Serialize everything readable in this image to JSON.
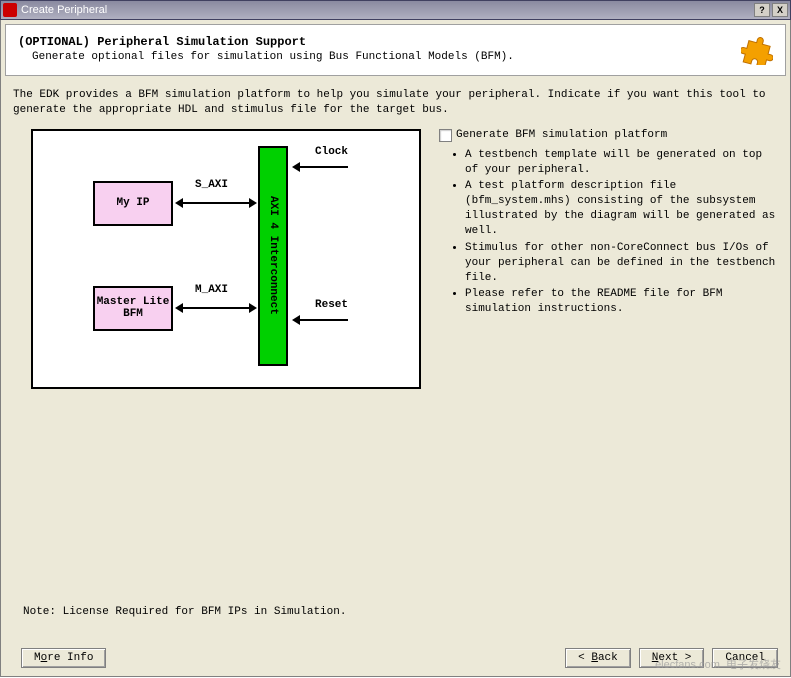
{
  "titlebar": {
    "title": "Create Peripheral",
    "help": "?",
    "close": "X"
  },
  "header": {
    "title": "(OPTIONAL) Peripheral Simulation Support",
    "subtitle": "Generate optional files for simulation using Bus Functional Models (BFM)."
  },
  "intro": "The EDK provides a BFM simulation platform to help you simulate your peripheral. Indicate if you want this tool to generate the appropriate HDL and stimulus file for the target bus.",
  "checkbox": {
    "label": "Generate BFM simulation platform"
  },
  "bullets": {
    "b1": "A testbench template will be generated on top of your peripheral.",
    "b2": "A test platform description file (bfm_system.mhs) consisting of the subsystem illustrated by the diagram will be generated as well.",
    "b3": "Stimulus for other non-CoreConnect bus I/Os of your peripheral can be defined in the testbench file.",
    "b4": "Please refer to the README file for BFM simulation instructions."
  },
  "diagram": {
    "my_ip": "My IP",
    "master": "Master Lite\nBFM",
    "s_axi": "S_AXI",
    "m_axi": "M_AXI",
    "clock": "Clock",
    "reset": "Reset",
    "interconnect": "AXI 4 Interconnect"
  },
  "note": "Note: License Required for BFM IPs in Simulation.",
  "footer": {
    "more_info_pre": "M",
    "more_info_u": "o",
    "more_info_post": "re Info",
    "back_pre": "< ",
    "back_u": "B",
    "back_post": "ack",
    "next_u": "N",
    "next_post": "ext >",
    "cancel": "Cancel"
  },
  "watermark": {
    "url": "elecfans.com",
    "txt": "电子发烧友"
  }
}
